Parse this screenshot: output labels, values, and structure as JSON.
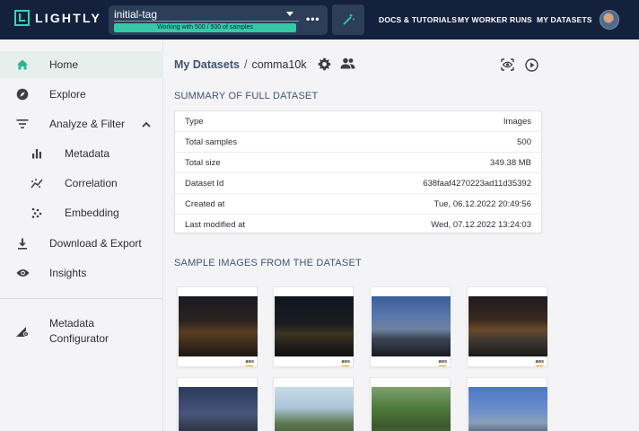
{
  "app": {
    "logo_text": "LIGHTLY",
    "accent_color": "#35c9a8",
    "topbar_color": "#14213d"
  },
  "tag": {
    "name": "initial-tag",
    "progress_text": "Working with 500 / 500 of samples",
    "more_label": "•••"
  },
  "topnav": {
    "docs": "DOCS & TUTORIALS",
    "worker_runs": "MY WORKER RUNS",
    "datasets": "MY DATASETS"
  },
  "sidebar": {
    "items": [
      {
        "label": "Home",
        "icon": "home-icon",
        "active": true
      },
      {
        "label": "Explore",
        "icon": "compass-icon"
      },
      {
        "label": "Analyze & Filter",
        "icon": "filter-icon",
        "expanded": true
      },
      {
        "label": "Metadata",
        "icon": "bar-chart-icon"
      },
      {
        "label": "Correlation",
        "icon": "correlation-icon"
      },
      {
        "label": "Embedding",
        "icon": "embedding-icon"
      },
      {
        "label": "Download & Export",
        "icon": "download-icon"
      },
      {
        "label": "Insights",
        "icon": "eye-icon"
      },
      {
        "label": "Metadata Configurator",
        "icon": "configurator-icon"
      }
    ]
  },
  "breadcrumb": {
    "root": "My Datasets",
    "separator": "/",
    "current": "comma10k"
  },
  "summary": {
    "title": "SUMMARY OF FULL DATASET",
    "rows": [
      {
        "key": "Type",
        "value": "Images"
      },
      {
        "key": "Total samples",
        "value": "500"
      },
      {
        "key": "Total size",
        "value": "349.38 MB"
      },
      {
        "key": "Dataset Id",
        "value": "638faaf4270223ad11d35392"
      },
      {
        "key": "Created at",
        "value": "Tue, 06.12.2022 20:49:56"
      },
      {
        "key": "Last modified at",
        "value": "Wed, 07.12.2022 13:24:03"
      }
    ]
  },
  "samples": {
    "title": "SAMPLE IMAGES FROM THE DATASET",
    "badge": "aws"
  }
}
